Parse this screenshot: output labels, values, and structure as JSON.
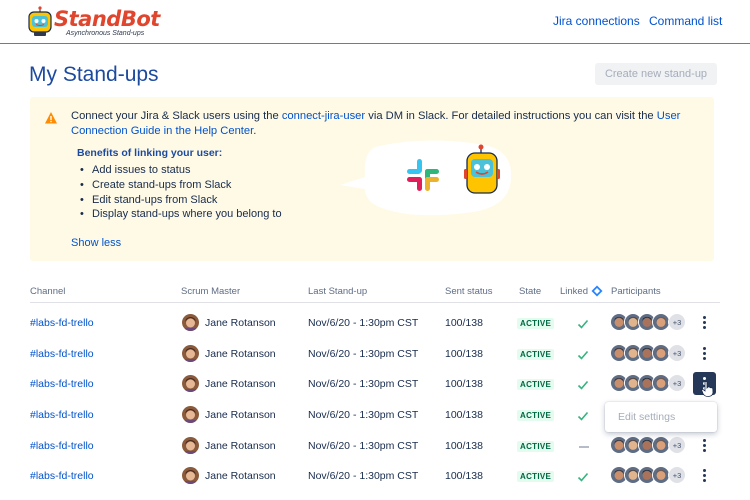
{
  "header": {
    "logo_title": "StandBot",
    "logo_subtitle": "Asynchronous Stand-ups",
    "nav": [
      "Jira connections",
      "Command list"
    ]
  },
  "page": {
    "title": "My Stand-ups",
    "create_button": "Create new stand-up"
  },
  "info_panel": {
    "text_prefix": "Connect your Jira & Slack users using the ",
    "text_command": "connect-jira-user",
    "text_middle": " via DM in Slack. For detailed instructions you can visit the ",
    "text_link": "User Connection Guide in the Help Center",
    "text_suffix": ".",
    "benefits_title": "Benefits of linking your user:",
    "benefits": [
      "Add issues to status",
      "Create stand-ups from Slack",
      "Edit stand-ups from Slack",
      "Display stand-ups where you belong to"
    ],
    "show_less": "Show less"
  },
  "table": {
    "headers": [
      "Channel",
      "Scrum Master",
      "Last Stand-up",
      "Sent status",
      "State",
      "Linked",
      "Participants"
    ],
    "rows": [
      {
        "channel": "#labs-fd-trello",
        "scrum_master": "Jane Rotanson",
        "last": "Nov/6/20 - 1:30pm CST",
        "sent": "100/138",
        "state": "ACTIVE",
        "linked": "check",
        "more": "+3"
      },
      {
        "channel": "#labs-fd-trello",
        "scrum_master": "Jane Rotanson",
        "last": "Nov/6/20 - 1:30pm CST",
        "sent": "100/138",
        "state": "ACTIVE",
        "linked": "check",
        "more": "+3"
      },
      {
        "channel": "#labs-fd-trello",
        "scrum_master": "Jane Rotanson",
        "last": "Nov/6/20 - 1:30pm CST",
        "sent": "100/138",
        "state": "ACTIVE",
        "linked": "check",
        "more": "+3"
      },
      {
        "channel": "#labs-fd-trello",
        "scrum_master": "Jane Rotanson",
        "last": "Nov/6/20 - 1:30pm CST",
        "sent": "100/138",
        "state": "ACTIVE",
        "linked": "check",
        "more": "+3"
      },
      {
        "channel": "#labs-fd-trello",
        "scrum_master": "Jane Rotanson",
        "last": "Nov/6/20 - 1:30pm CST",
        "sent": "100/138",
        "state": "ACTIVE",
        "linked": "dash",
        "more": "+3"
      },
      {
        "channel": "#labs-fd-trello",
        "scrum_master": "Jane Rotanson",
        "last": "Nov/6/20 - 1:30pm CST",
        "sent": "100/138",
        "state": "ACTIVE",
        "linked": "check",
        "more": "+3"
      }
    ],
    "dropdown_item": "Edit settings"
  },
  "colors": {
    "brand": "#e0452e",
    "link": "#0052cc",
    "title": "#1c4a9e",
    "panel_bg": "#fffae6",
    "active_green": "#006644",
    "check_green": "#36b37e"
  },
  "icons": [
    "standbot-robot-icon",
    "warning-icon",
    "slack-logo-icon",
    "linked-diamond-icon",
    "check-icon",
    "kebab-menu-icon",
    "hand-cursor-icon"
  ]
}
